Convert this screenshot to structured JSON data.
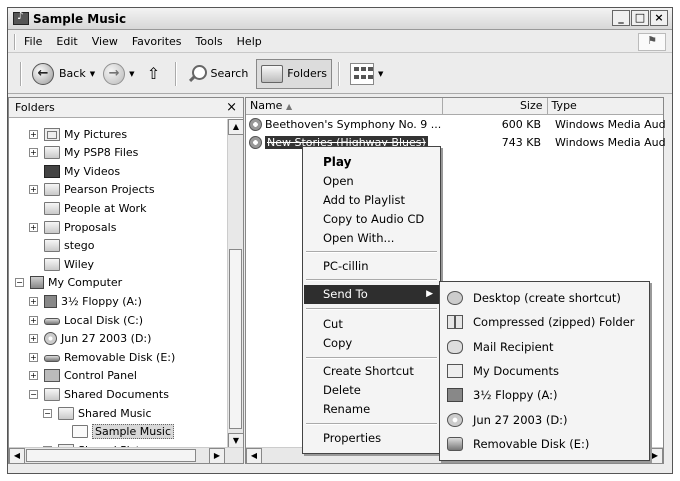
{
  "window": {
    "title": "Sample Music",
    "buttons": [
      "_",
      "□",
      "×"
    ]
  },
  "menubar": {
    "items": [
      "File",
      "Edit",
      "View",
      "Favorites",
      "Tools",
      "Help"
    ]
  },
  "toolbar": {
    "back_label": "Back",
    "search_label": "Search",
    "folders_label": "Folders"
  },
  "folders_pane": {
    "title": "Folders",
    "close": "×",
    "tree": [
      {
        "label": "My Pictures",
        "icon": "pictures-icon",
        "expander": "+",
        "level": 1
      },
      {
        "label": "My PSP8 Files",
        "icon": "folder-icon",
        "expander": "+",
        "level": 1
      },
      {
        "label": "My Videos",
        "icon": "video-icon",
        "expander": "",
        "level": 1
      },
      {
        "label": "Pearson Projects",
        "icon": "folder-icon",
        "expander": "+",
        "level": 1
      },
      {
        "label": "People at Work",
        "icon": "folder-icon",
        "expander": "",
        "level": 1
      },
      {
        "label": "Proposals",
        "icon": "folder-icon",
        "expander": "+",
        "level": 1
      },
      {
        "label": "stego",
        "icon": "folder-icon",
        "expander": "",
        "level": 1
      },
      {
        "label": "Wiley",
        "icon": "folder-icon",
        "expander": "",
        "level": 1
      },
      {
        "label": "My Computer",
        "icon": "computer-icon",
        "expander": "−",
        "level": 0
      },
      {
        "label": "3½ Floppy (A:)",
        "icon": "floppy-icon",
        "expander": "+",
        "level": 1
      },
      {
        "label": "Local Disk (C:)",
        "icon": "disk-icon",
        "expander": "+",
        "level": 1
      },
      {
        "label": "Jun 27 2003 (D:)",
        "icon": "cd-icon",
        "expander": "+",
        "level": 1
      },
      {
        "label": "Removable Disk (E:)",
        "icon": "disk-icon",
        "expander": "+",
        "level": 1
      },
      {
        "label": "Control Panel",
        "icon": "panel-icon",
        "expander": "+",
        "level": 1
      },
      {
        "label": "Shared Documents",
        "icon": "folder-icon",
        "expander": "−",
        "level": 1
      },
      {
        "label": "Shared Music",
        "icon": "folder-icon",
        "expander": "−",
        "level": 2
      },
      {
        "label": "Sample Music",
        "icon": "folder-icon",
        "expander": "",
        "level": 3,
        "selected": true
      },
      {
        "label": "Shared Pictures",
        "icon": "pictures-icon",
        "expander": "+",
        "level": 2
      }
    ]
  },
  "file_list": {
    "columns": {
      "name": "Name",
      "size": "Size",
      "type": "Type"
    },
    "rows": [
      {
        "name": "Beethoven's Symphony No. 9 ...",
        "size": "600 KB",
        "type": "Windows Media Aud..."
      },
      {
        "name": "New Stories (Highway Blues)",
        "size": "743 KB",
        "type": "Windows Media Aud..."
      }
    ]
  },
  "context_menu": {
    "items": [
      "Play",
      "Open",
      "Add to Playlist",
      "Copy to Audio CD",
      "Open With...",
      "PC-cillin",
      "Send To",
      "Cut",
      "Copy",
      "Create Shortcut",
      "Delete",
      "Rename",
      "Properties"
    ]
  },
  "send_to_menu": {
    "items": [
      {
        "label": "Desktop (create shortcut)",
        "icon": "desktop-icon"
      },
      {
        "label": "Compressed (zipped) Folder",
        "icon": "zip-icon"
      },
      {
        "label": "Mail Recipient",
        "icon": "mail-icon"
      },
      {
        "label": "My Documents",
        "icon": "docs-icon"
      },
      {
        "label": "3½ Floppy (A:)",
        "icon": "floppy-icon"
      },
      {
        "label": "Jun 27 2003 (D:)",
        "icon": "cd-icon"
      },
      {
        "label": "Removable Disk (E:)",
        "icon": "disk-icon"
      }
    ]
  }
}
